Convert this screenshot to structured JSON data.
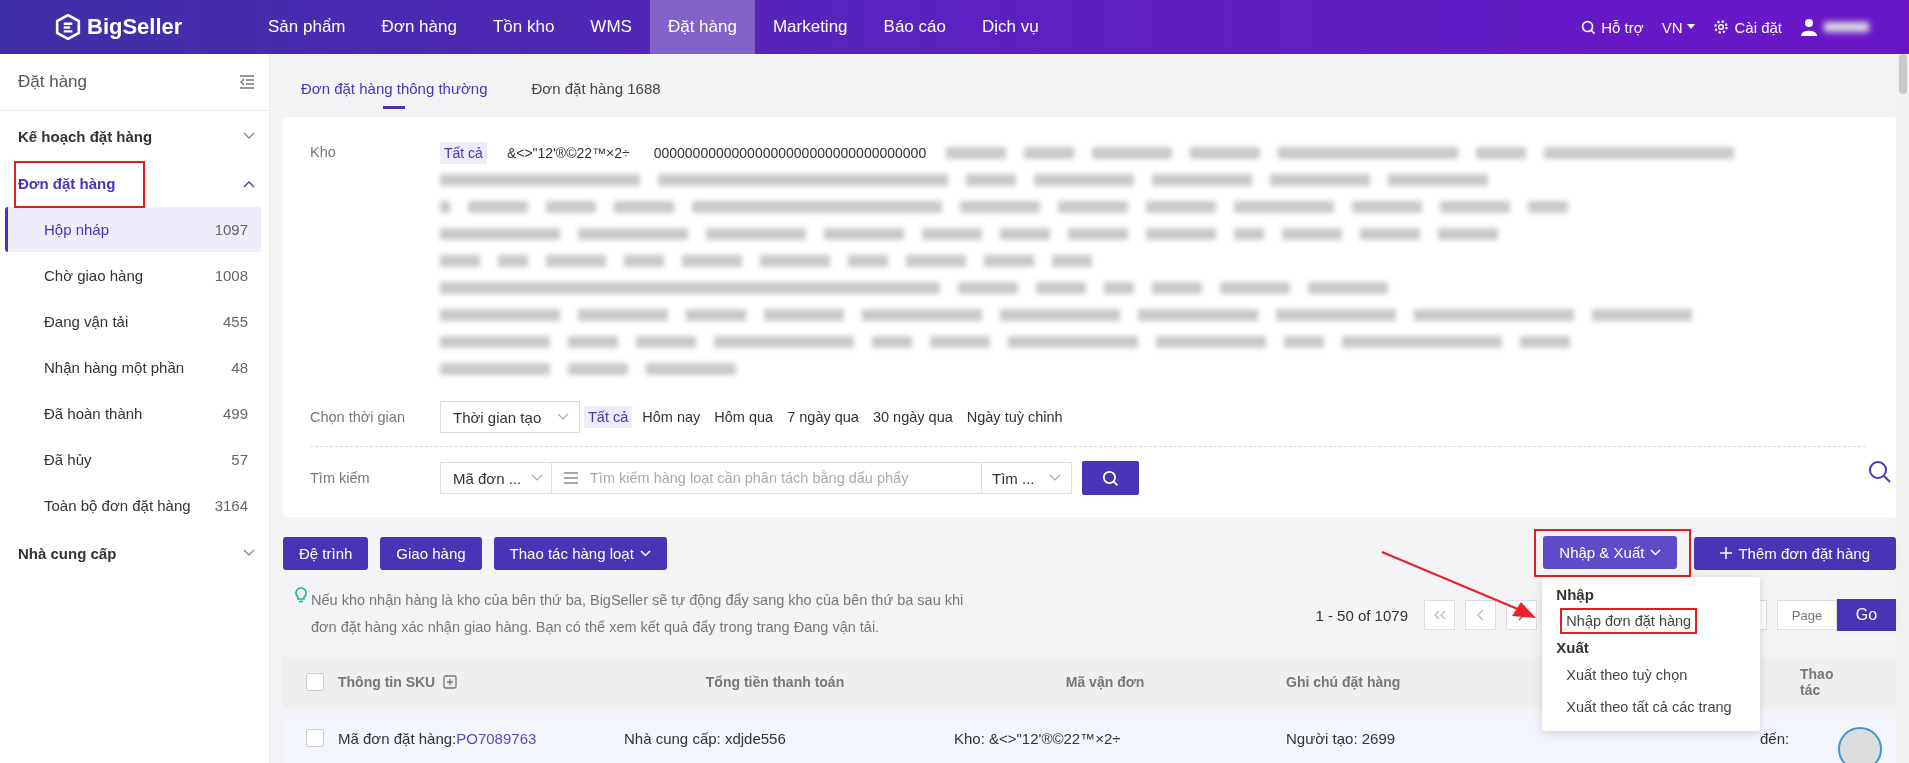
{
  "brand": {
    "name": "BigSeller"
  },
  "nav": [
    {
      "label": "Sản phẩm",
      "selected": false
    },
    {
      "label": "Đơn hàng",
      "selected": false
    },
    {
      "label": "Tồn kho",
      "selected": false
    },
    {
      "label": "WMS",
      "selected": false
    },
    {
      "label": "Đặt hàng",
      "selected": true
    },
    {
      "label": "Marketing",
      "selected": false
    },
    {
      "label": "Báo cáo",
      "selected": false
    },
    {
      "label": "Dịch vụ",
      "selected": false
    }
  ],
  "top_right": {
    "help": "Hỗ trợ",
    "language": "VN",
    "settings": "Cài đặt"
  },
  "sidebar": {
    "title": "Đặt hàng",
    "groups": [
      {
        "label": "Kế hoạch đặt hàng",
        "expanded": false,
        "highlighted": false
      },
      {
        "label": "Đơn đặt hàng",
        "expanded": true,
        "highlighted": true,
        "children": [
          {
            "label": "Hộp nháp",
            "count": "1097",
            "selected": true
          },
          {
            "label": "Chờ giao hàng",
            "count": "1008",
            "selected": false
          },
          {
            "label": "Đang vận tải",
            "count": "455",
            "selected": false
          },
          {
            "label": "Nhận hàng một phần",
            "count": "48",
            "selected": false
          },
          {
            "label": "Đã hoàn thành",
            "count": "499",
            "selected": false
          },
          {
            "label": "Đã hủy",
            "count": "57",
            "selected": false
          },
          {
            "label": "Toàn bộ đơn đặt hàng",
            "count": "3164",
            "selected": false
          }
        ]
      },
      {
        "label": "Nhà cung cấp",
        "expanded": false,
        "highlighted": false
      }
    ]
  },
  "tabs": [
    {
      "label": "Đơn đặt hàng thông thường",
      "selected": true
    },
    {
      "label": "Đơn đặt hàng 1688",
      "selected": false
    }
  ],
  "filters": {
    "warehouse": {
      "label": "Kho",
      "options": [
        {
          "label": "Tất cả",
          "selected": true
        },
        {
          "label": "&<>\"12'®©22™×2÷",
          "selected": false
        },
        {
          "label": "00000000000000000000000000000000000",
          "selected": false
        }
      ]
    },
    "time": {
      "label": "Chọn thời gian",
      "select": "Thời gian tạo",
      "options": [
        {
          "label": "Tất cả",
          "selected": true
        },
        {
          "label": "Hôm nay",
          "selected": false
        },
        {
          "label": "Hôm qua",
          "selected": false
        },
        {
          "label": "7 ngày qua",
          "selected": false
        },
        {
          "label": "30 ngày qua",
          "selected": false
        },
        {
          "label": "Ngày tuỳ chỉnh",
          "selected": false
        }
      ]
    },
    "search": {
      "label": "Tìm kiếm",
      "field_select": "Mã đơn ...",
      "placeholder": "Tìm kiếm hàng loạt cần phân tách bằng dấu phẩy",
      "mode_select": "Tìm ..."
    }
  },
  "actions": {
    "buttons": [
      {
        "label": "Đệ trình",
        "kind": "plain"
      },
      {
        "label": "Giao hàng",
        "kind": "plain"
      },
      {
        "label": "Thao tác hàng loạt",
        "kind": "dropdown"
      }
    ],
    "import_export": {
      "label": "Nhập & Xuất",
      "highlighted": true,
      "expanded": true
    },
    "add": "Thêm đơn đặt hàng"
  },
  "hint": "Nếu kho nhận hàng là kho của bên thứ ba, BigSeller sẽ tự động đẩy sang kho của bên thứ ba sau khi đơn đặt hàng xác nhận giao hàng. Bạn có thể xem kết quả đẩy trong trang Đang vận tải.",
  "pagination": {
    "range": "1 - 50 of 1079",
    "page_placeholder": "Page",
    "go": "Go"
  },
  "dropdown": {
    "sections": [
      {
        "heading": "Nhập",
        "items": [
          {
            "label": "Nhập đơn đặt hàng",
            "highlighted": true
          }
        ]
      },
      {
        "heading": "Xuất",
        "items": [
          {
            "label": "Xuất theo tuỳ chọn",
            "highlighted": false
          },
          {
            "label": "Xuất theo tất cả các trang",
            "highlighted": false
          }
        ]
      }
    ]
  },
  "table": {
    "all_checked": false,
    "columns": [
      "Thông tin SKU",
      "Tổng tiền thanh toán",
      "Mã vận đơn",
      "Ghi chú đặt hàng",
      "Thao tác"
    ],
    "rows": [
      {
        "checked": false,
        "order_label": "Mã đơn đặt hàng:",
        "order_no": "PO7089763",
        "supplier": "Nhà cung cấp: xdjde556",
        "warehouse": "Kho: &<>\"12'®©22™×2÷",
        "creator": "Người tạo: 2699",
        "column_5": "đến:"
      }
    ]
  }
}
